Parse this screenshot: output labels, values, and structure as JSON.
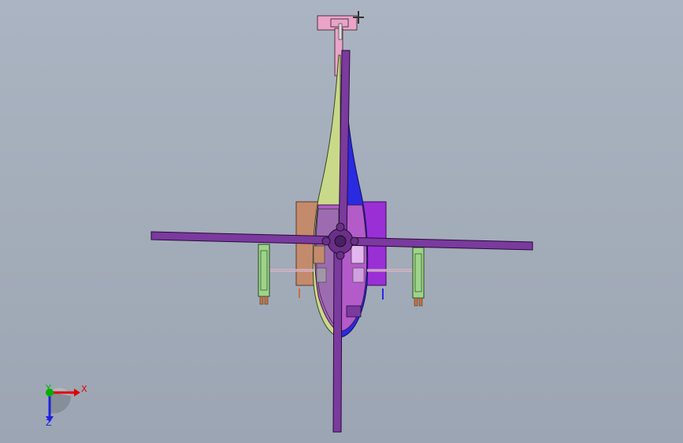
{
  "viewport": {
    "background_top": "#aab4c2",
    "background_bottom": "#9ca5b3"
  },
  "model": {
    "colors": {
      "rotor_blade": "#7a3a9e",
      "rotor_hub": "#6b2f8a",
      "fuselage_left": "#c9d98a",
      "fuselage_right": "#2a2ae0",
      "cabin": "#b35cc9",
      "tail_boom": "#e8a5c8",
      "tail_fin": "#e9a4c8",
      "panel_left": "#c48a6c",
      "panel_right": "#9a2fd6",
      "skids": "#9ed48a"
    }
  },
  "triad": {
    "x_label": "X",
    "y_label": "Y",
    "z_label": "Z",
    "x_color": "#e00000",
    "y_color": "#00b000",
    "z_color": "#2020e0"
  }
}
